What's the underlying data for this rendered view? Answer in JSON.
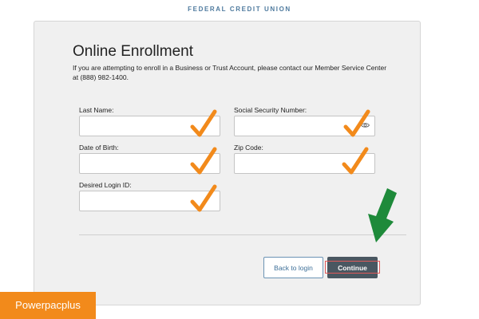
{
  "header": {
    "brand": "FEDERAL CREDIT UNION"
  },
  "form": {
    "title": "Online Enrollment",
    "intro": "If you are attempting to enroll in a Business or Trust Account, please contact our Member Service Center at (888) 982-1400.",
    "fields": {
      "last_name": {
        "label": "Last Name:",
        "value": ""
      },
      "ssn": {
        "label": "Social Security Number:",
        "value": ""
      },
      "dob": {
        "label": "Date of Birth:",
        "value": ""
      },
      "zip": {
        "label": "Zip Code:",
        "value": ""
      },
      "login_id": {
        "label": "Desired Login ID:",
        "value": ""
      }
    },
    "buttons": {
      "back": "Back to login",
      "continue": "Continue"
    }
  },
  "annotations": {
    "check_color": "#f28a1b",
    "arrow_color": "#1e8a3a",
    "highlight_color": "#e05a5a"
  },
  "watermark": {
    "text": "Powerpacplus",
    "color": "#f28a1b"
  },
  "icons": [
    "eye-icon",
    "checkmark-icon",
    "down-arrow-icon"
  ]
}
